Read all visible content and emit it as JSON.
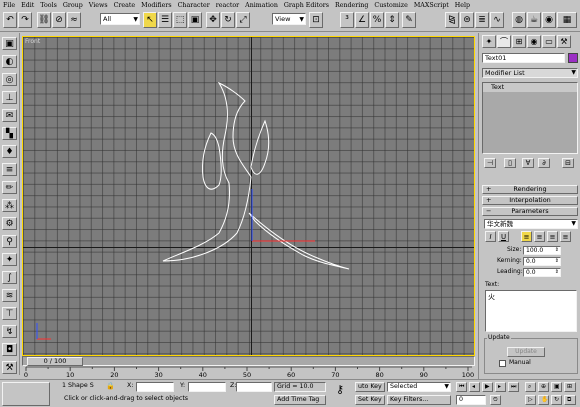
{
  "menu": [
    "File",
    "Edit",
    "Tools",
    "Group",
    "Views",
    "Create",
    "Modifiers",
    "Character",
    "reactor",
    "Animation",
    "Graph Editors",
    "Rendering",
    "Customize",
    "MAXScript",
    "Help"
  ],
  "toolbar": {
    "selection_filter": "All",
    "reference_coord": "View",
    "icons": [
      "undo-icon",
      "redo-icon",
      "link-icon",
      "unlink-icon",
      "bind-spacewarp-icon",
      "select-icon",
      "select-by-name-icon",
      "select-region-icon",
      "move-icon",
      "rotate-icon",
      "scale-icon",
      "pivot-icon",
      "snap-icon",
      "angle-snap-icon",
      "percent-snap-icon",
      "mirror-icon",
      "align-icon",
      "layers-icon",
      "curve-editor-icon",
      "material-editor-icon",
      "render-scene-icon",
      "quick-render-icon",
      "render-type-icon"
    ]
  },
  "viewport": {
    "label": "Front"
  },
  "time_slider": {
    "label": "0 / 100"
  },
  "ruler": {
    "ticks": [
      "0",
      "10",
      "20",
      "30",
      "40",
      "50",
      "60",
      "70",
      "80",
      "90",
      "100"
    ]
  },
  "command_panel": {
    "object_name": "Text01",
    "object_color": "#9b2fc4",
    "modifier_list": "Modifier List",
    "stack_item": "Text",
    "rollouts": {
      "rendering": "Rendering",
      "interpolation": "Interpolation",
      "parameters": "Parameters"
    },
    "font": "华文新魏",
    "italic": "I",
    "underline": "U",
    "size_label": "Size:",
    "size_value": "100.0",
    "kerning_label": "Kerning:",
    "kerning_value": "0.0",
    "leading_label": "Leading:",
    "leading_value": "0.0",
    "text_label": "Text:",
    "text_value": "火",
    "update_group": "Update",
    "update_button": "Update",
    "manual_label": "Manual"
  },
  "status": {
    "selection_count": "1 Shape S",
    "x_label": "X:",
    "y_label": "Y:",
    "z_label": "Z:",
    "grid": "Grid = 10.0",
    "auto_key": "uto Key",
    "set_key": "Set Key",
    "selected": "Selected",
    "key_filters": "Key Filters...",
    "add_time_tag": "Add Time Tag",
    "prompt": "Click or click-and-drag to select objects",
    "frame": "0"
  }
}
